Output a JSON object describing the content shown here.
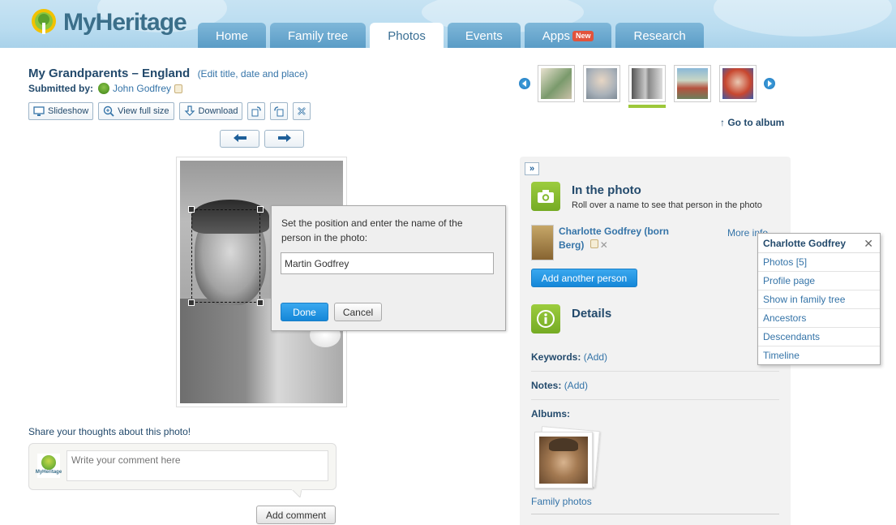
{
  "app": {
    "logo_text": "MyHeritage"
  },
  "nav": {
    "tabs": [
      {
        "label": "Home"
      },
      {
        "label": "Family tree"
      },
      {
        "label": "Photos"
      },
      {
        "label": "Events"
      },
      {
        "label": "Apps",
        "badge": "New"
      },
      {
        "label": "Research"
      }
    ],
    "active_tab": "Photos"
  },
  "photo": {
    "title": "My Grandparents – England",
    "edit_link": "(Edit title, date and place)",
    "submitted_label": "Submitted by:",
    "submitted_by": "John Godfrey"
  },
  "toolbar": {
    "slideshow": "Slideshow",
    "view_full": "View full size",
    "download": "Download"
  },
  "tag_popup": {
    "message": "Set the position and enter the name of the person in the photo:",
    "name_value": "Martin Godfrey",
    "done": "Done",
    "cancel": "Cancel"
  },
  "comments": {
    "share_label": "Share your thoughts about this photo!",
    "avatar_text": "MyHeritage",
    "placeholder": "Write your comment here",
    "add_button": "Add comment"
  },
  "album": {
    "go_to_album": "Go to album",
    "active_thumb": 2
  },
  "panel": {
    "in_photo_title": "In the photo",
    "in_photo_sub": "Roll over a name to see that person in the photo",
    "person_name": "Charlotte Godfrey (born Berg)",
    "more_info": "More info",
    "add_person": "Add another person",
    "details_title": "Details",
    "keywords_label": "Keywords:",
    "keywords_add": "(Add)",
    "notes_label": "Notes:",
    "notes_add": "(Add)",
    "albums_label": "Albums:",
    "album_name": "Family photos"
  },
  "dropdown": {
    "title": "Charlotte Godfrey",
    "items": [
      {
        "label": "Photos [5]"
      },
      {
        "label": "Profile page"
      },
      {
        "label": "Show in family tree"
      },
      {
        "label": "Ancestors"
      },
      {
        "label": "Descendants"
      },
      {
        "label": "Timeline"
      }
    ]
  },
  "colors": {
    "brand_blue": "#3574a8",
    "accent_green": "#9dc83a",
    "button_blue": "#1587d8"
  }
}
